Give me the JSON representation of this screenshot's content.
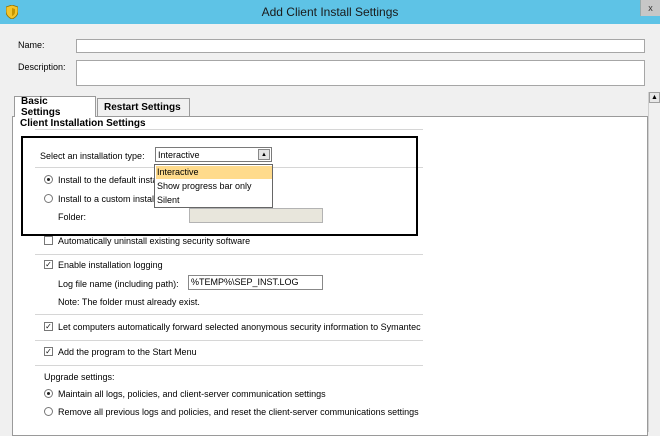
{
  "window": {
    "title": "Add Client Install Settings",
    "close_glyph": "x"
  },
  "form": {
    "name_label": "Name:",
    "name_value": "",
    "description_label": "Description:",
    "description_value": ""
  },
  "tabs": [
    {
      "label": "Basic Settings",
      "active": true
    },
    {
      "label": "Restart Settings",
      "active": false
    }
  ],
  "client_installation": {
    "group_title": "Client Installation Settings",
    "install_type_label": "Select an installation type:",
    "install_type_selected": "Interactive",
    "install_type_options": [
      "Interactive",
      "Show progress bar only",
      "Silent"
    ],
    "install_default_label": "Install to the default insta",
    "install_default_checked": true,
    "install_custom_label": "Install to a custom install",
    "install_custom_checked": false,
    "folder_label": "Folder:",
    "auto_uninstall_label": "Automatically uninstall existing security software",
    "auto_uninstall_checked": false,
    "enable_logging_label": "Enable installation logging",
    "enable_logging_checked": true,
    "log_file_label": "Log file name (including path):",
    "log_file_value": "%TEMP%\\SEP_INST.LOG",
    "note_text": "Note: The folder must already exist.",
    "forward_info_label": "Let computers automatically forward selected anonymous security information to Symantec",
    "forward_info_checked": true,
    "start_menu_label": "Add the program to the Start Menu",
    "start_menu_checked": true,
    "upgrade_label": "Upgrade settings:",
    "maintain_logs_label": "Maintain all logs, policies, and client-server communication settings",
    "maintain_logs_checked": true,
    "remove_logs_label": "Remove all previous logs and policies, and reset the client-server communications settings",
    "remove_logs_checked": false
  },
  "colors": {
    "titlebar": "#5ec3e6",
    "dropdown_highlight": "#ffdb8c"
  }
}
